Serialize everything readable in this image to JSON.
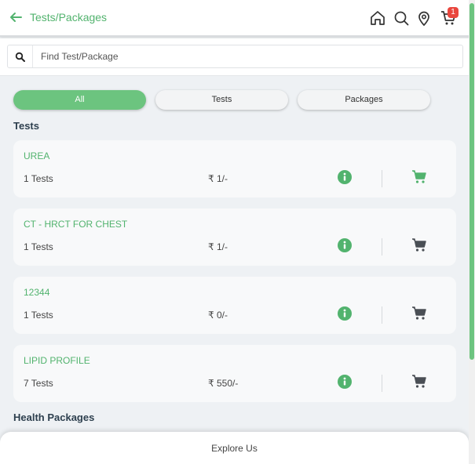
{
  "header": {
    "title": "Tests/Packages",
    "cart_count": "1",
    "icons": [
      "back-arrow-icon",
      "home-icon",
      "search-icon",
      "location-pin-icon",
      "cart-icon"
    ]
  },
  "search": {
    "placeholder": "Find Test/Package",
    "value": ""
  },
  "filters": [
    {
      "label": "All",
      "active": true
    },
    {
      "label": "Tests",
      "active": false
    },
    {
      "label": "Packages",
      "active": false
    }
  ],
  "sections": {
    "tests_title": "Tests",
    "packages_title": "Health Packages"
  },
  "tests": [
    {
      "name": "UREA",
      "count": "1 Tests",
      "price": "₹ 1/-",
      "in_cart": true
    },
    {
      "name": "CT - HRCT FOR CHEST",
      "count": "1 Tests",
      "price": "₹ 1/-",
      "in_cart": false
    },
    {
      "name": "12344",
      "count": "1 Tests",
      "price": "₹ 0/-",
      "in_cart": false
    },
    {
      "name": "LIPID PROFILE",
      "count": "7 Tests",
      "price": "₹ 550/-",
      "in_cart": false
    }
  ],
  "bottom": {
    "explore_label": "Explore Us"
  },
  "colors": {
    "accent": "#52b36e",
    "pill_active": "#6cc47f",
    "badge": "#e9463d",
    "cart_active": "#52b36e",
    "cart_inactive": "#4a4f55"
  }
}
